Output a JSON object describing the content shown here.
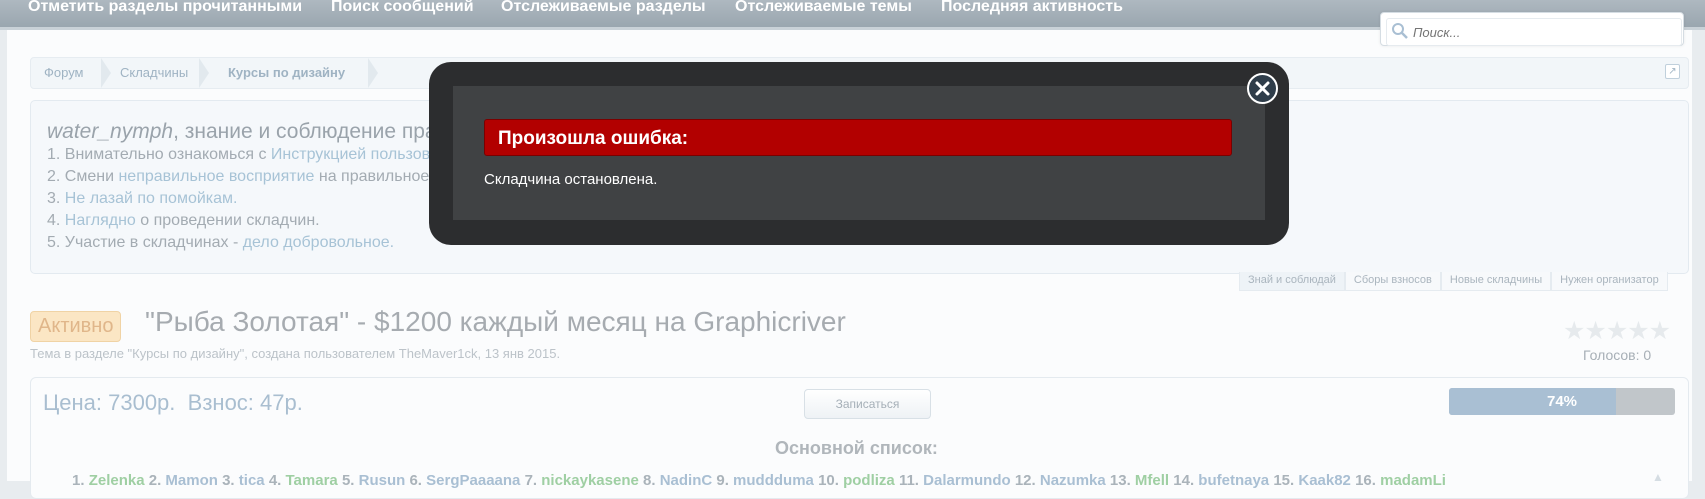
{
  "nav": {
    "items": [
      {
        "label": "Отметить разделы прочитанными"
      },
      {
        "label": "Поиск сообщений"
      },
      {
        "label": "Отслеживаемые разделы"
      },
      {
        "label": "Отслеживаемые темы"
      },
      {
        "label": "Последняя активность"
      }
    ],
    "search_placeholder": "Поиск..."
  },
  "breadcrumb": {
    "items": [
      {
        "label": "Форум"
      },
      {
        "label": "Складчины"
      },
      {
        "label": "Курсы по дизайну"
      }
    ]
  },
  "notice": {
    "user": "water_nymph",
    "title_rest": ", знание и соблюдение правил",
    "l1_pre": "1. Внимательно ознакомься с ",
    "l1_link": "Инструкцией пользования клубом.",
    "l2_pre": "2. Смени ",
    "l2_link": "неправильное восприятие",
    "l2_post": " на правильное.",
    "l3_pre": "3. ",
    "l3_link": "Не лазай по помойкам.",
    "l4_pre": "4. ",
    "l4_link": "Наглядно",
    "l4_post": " о проведении складчин.",
    "l5_pre": "5. Участие в складчинах - ",
    "l5_link": "дело добровольное."
  },
  "tabs": [
    {
      "label": "Знай и соблюдай"
    },
    {
      "label": "Сборы взносов"
    },
    {
      "label": "Новые складчины"
    },
    {
      "label": "Нужен организатор"
    }
  ],
  "thread": {
    "status": "Активно",
    "title": "\"Рыба Золотая\" - $1200 каждый месяц на Graphicriver",
    "meta": "Тема в разделе \"Курсы по дизайну\", создана пользователем TheMaver1ck, 13 янв 2015.",
    "stars": "★★★★★",
    "votes": "Голосов: 0"
  },
  "details": {
    "price": "Цена: 7300р.",
    "fee": "Взнос: 47р.",
    "join_label": "Записаться",
    "progress_label": "74%",
    "progress": 0.74,
    "list_title": "Основной список:",
    "list_partial": [
      {
        "n": "1. ",
        "name": "Zelenka"
      },
      {
        "n": "2. ",
        "name": "Mamon"
      },
      {
        "n": "3. ",
        "name": "tica"
      },
      {
        "n": "4. ",
        "name": "Tamara"
      },
      {
        "n": "5. ",
        "name": "Rusun"
      },
      {
        "n": "6. ",
        "name": "SergPaaaana"
      },
      {
        "n": "7. ",
        "name": "nickaykasene"
      },
      {
        "n": "8. ",
        "name": "NadinC"
      },
      {
        "n": "9. ",
        "name": "muddduma"
      },
      {
        "n": "10. ",
        "name": "podliza"
      },
      {
        "n": "11. ",
        "name": "Dalarmundo"
      },
      {
        "n": "12. ",
        "name": "Nazumka"
      },
      {
        "n": "13. ",
        "name": "Mfell"
      },
      {
        "n": "14. ",
        "name": "bufetnaya"
      },
      {
        "n": "15. ",
        "name": "Kaak82"
      },
      {
        "n": "16. ",
        "name": "madamLi"
      }
    ]
  },
  "modal": {
    "error_title": "Произошла ошибка:",
    "error_message": "Складчина остановлена."
  }
}
